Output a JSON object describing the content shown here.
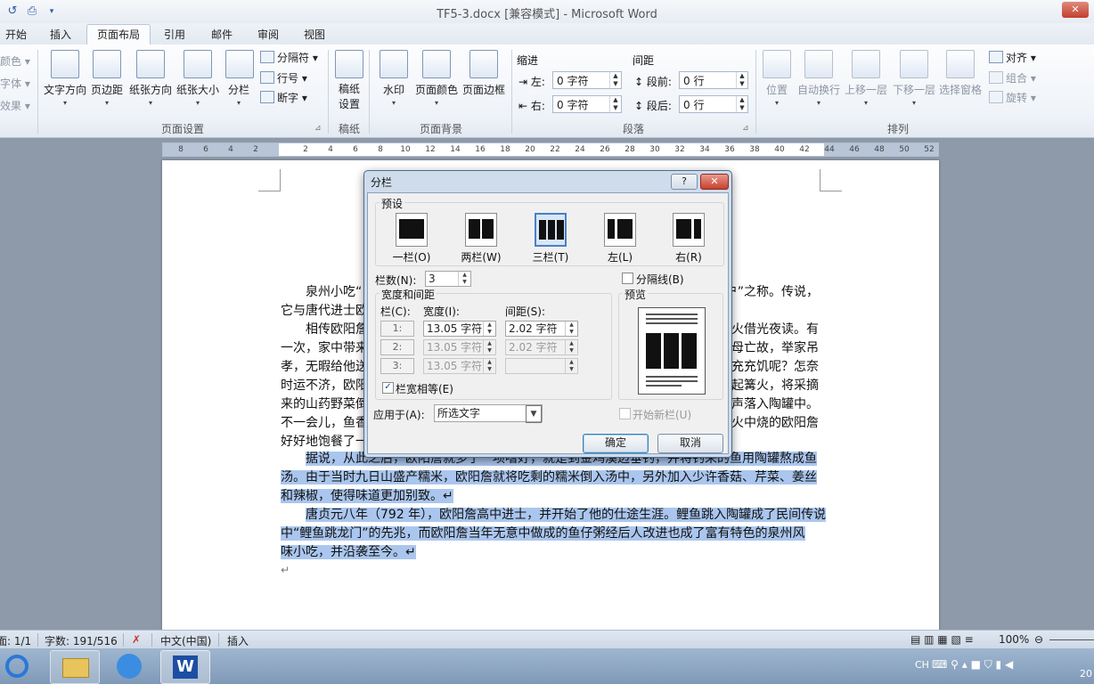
{
  "window": {
    "title": "TF5-3.docx [兼容模式] - Microsoft Word",
    "close": "✕"
  },
  "tabs": [
    "开始",
    "插入",
    "页面布局",
    "引用",
    "邮件",
    "审阅",
    "视图"
  ],
  "ribbon": {
    "left_partial": [
      "颜色",
      "字体",
      "效果"
    ],
    "page_setup": {
      "label": "页面设置",
      "buttons": [
        "文字方向",
        "页边距",
        "纸张方向",
        "纸张大小",
        "分栏"
      ],
      "small": [
        "分隔符",
        "行号",
        "断字"
      ]
    },
    "manuscript": {
      "label": "稿纸",
      "button": "稿纸\n设置"
    },
    "page_background": {
      "label": "页面背景",
      "buttons": [
        "水印",
        "页面颜色",
        "页面边框"
      ]
    },
    "paragraph": {
      "label": "段落",
      "indent_title": "缩进",
      "spacing_title": "间距",
      "left_label": "左:",
      "right_label": "右:",
      "before_label": "段前:",
      "after_label": "段后:",
      "left_value": "0 字符",
      "right_value": "0 字符",
      "before_value": "0 行",
      "after_value": "0 行"
    },
    "arrange": {
      "label": "排列",
      "buttons": [
        "位置",
        "自动换行",
        "上移一层",
        "下移一层",
        "选择窗格"
      ],
      "small": [
        "对齐",
        "组合",
        "旋转"
      ]
    }
  },
  "ruler": [
    "8",
    "6",
    "4",
    "2",
    "",
    "2",
    "4",
    "6",
    "8",
    "10",
    "12",
    "14",
    "16",
    "18",
    "20",
    "22",
    "24",
    "26",
    "28",
    "30",
    "32",
    "34",
    "36",
    "38",
    "40",
    "42",
    "44",
    "46",
    "48",
    "50",
    "52"
  ],
  "document": {
    "lines": [
      {
        "text": "泉州小吃“",
        "indent": true
      },
      {
        "text": "它与唐代进士欧",
        "indent": false
      },
      {
        "text": "相传欧阳詹",
        "indent": true
      },
      {
        "text": "一次，家中带来",
        "indent": false
      },
      {
        "text": "孝，无暇给他送",
        "indent": false
      },
      {
        "text": "时运不济，欧阳",
        "indent": false
      },
      {
        "text": "来的山药野菜倒",
        "indent": false
      },
      {
        "text": "不一会儿，鱼香",
        "indent": false
      },
      {
        "text": "好好地饱餐了一",
        "indent": false
      }
    ],
    "right_fragments": [
      "户”之称。传说，",
      "",
      "火借光夜读。有",
      "母亡故，举家吊",
      "充充饥呢？怎奈",
      "起篝火，将采摘",
      "一声落入陶罐中。",
      "火中烧的欧阳詹",
      ""
    ],
    "selected": [
      {
        "text": "据说，从此之后，欧阳詹就多了一项嗜好，就是到金鸡溪边垂钓，并将钓来的鱼用陶罐熬成鱼",
        "indent": true
      },
      {
        "text": "汤。由于当时九日山盛产糯米，欧阳詹就将吃剩的糯米倒入汤中，另外加入少许香菇、芹菜、姜丝",
        "indent": false
      },
      {
        "text": "和辣椒，使得味道更加别致。↵",
        "indent": false
      },
      {
        "text": "唐贞元八年（792 年），欧阳詹高中进士，并开始了他的仕途生涯。鲤鱼跳入陶罐成了民间传说",
        "indent": true
      },
      {
        "text": "中“鲤鱼跳龙门”的先兆，而欧阳詹当年无意中做成的鱼仔粥经后人改进也成了富有特色的泉州风",
        "indent": false
      },
      {
        "text": "味小吃，并沿袭至今。↵",
        "indent": false
      }
    ],
    "end_mark": "↵"
  },
  "dialog": {
    "title": "分栏",
    "help": "?",
    "close": "✕",
    "presets_title": "预设",
    "presets": [
      {
        "label": "一栏(O)",
        "cols": 1,
        "selected": false
      },
      {
        "label": "两栏(W)",
        "cols": 2,
        "selected": false
      },
      {
        "label": "三栏(T)",
        "cols": 3,
        "selected": true
      },
      {
        "label": "左(L)",
        "cols": 0,
        "selected": false
      },
      {
        "label": "右(R)",
        "cols": 0,
        "selected": false
      }
    ],
    "num_cols_label": "栏数(N):",
    "num_cols_value": "3",
    "separator_label": "分隔线(B)",
    "width_spacing_title": "宽度和间距",
    "col_header": "栏(C):",
    "width_header": "宽度(I):",
    "spacing_header": "间距(S):",
    "rows": [
      {
        "index": "1:",
        "width": "13.05 字符",
        "spacing": "2.02 字符"
      },
      {
        "index": "2:",
        "width": "13.05 字符",
        "spacing": "2.02 字符"
      },
      {
        "index": "3:",
        "width": "13.05 字符",
        "spacing": ""
      }
    ],
    "equal_width_label": "栏宽相等(E)",
    "preview_title": "预览",
    "apply_label": "应用于(A):",
    "apply_value": "所选文字",
    "new_column_label": "开始新栏(U)",
    "ok": "确定",
    "cancel": "取消"
  },
  "status": {
    "page": "页面: 1/1",
    "words": "字数: 191/516",
    "language": "中文(中国)",
    "mode": "插入",
    "zoom": "100%"
  },
  "tray": {
    "ime": "CH",
    "clock": "20"
  }
}
